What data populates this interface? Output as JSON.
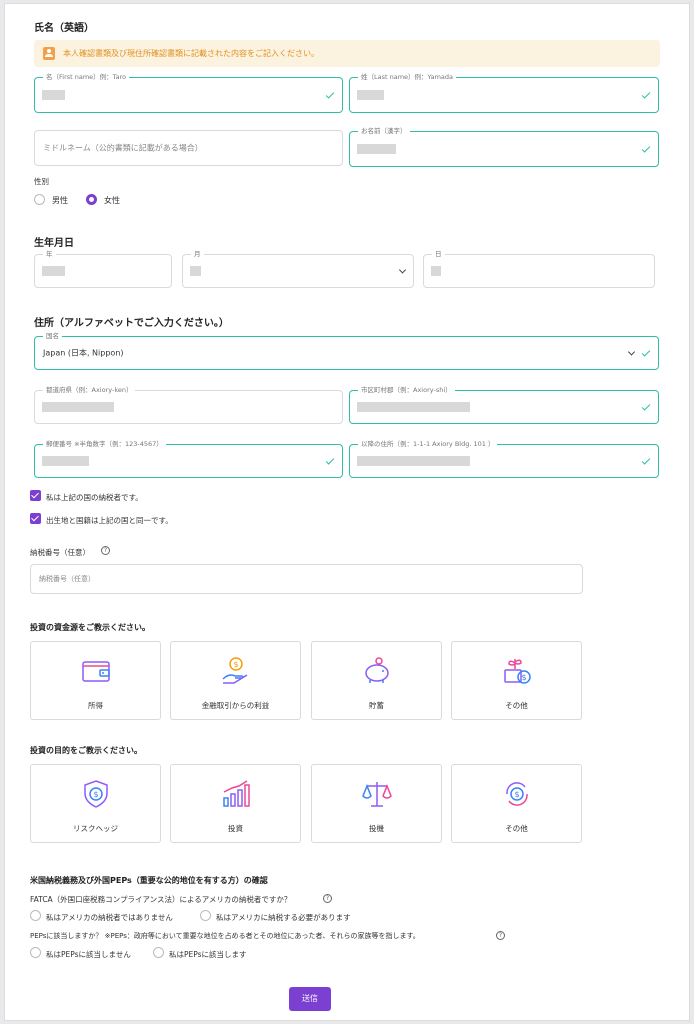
{
  "name_section": {
    "title": "氏名（英語）",
    "notice": "本人確認書類及び現住所確認書類に記載された内容をご記入ください。",
    "first_name_label": "名（First name）例：Taro",
    "last_name_label": "姓（Last name）例：Yamada",
    "middle_name_placeholder": "ミドルネーム（公的書類に記載がある場合）",
    "kanji_name_label": "お名前（漢字）"
  },
  "gender": {
    "label": "性別",
    "options": [
      "男性",
      "女性"
    ],
    "selected": "女性"
  },
  "birth": {
    "title": "生年月日",
    "year_label": "年",
    "month_label": "月",
    "day_label": "日"
  },
  "address": {
    "title": "住所（アルファベットでご入力ください。）",
    "country_label": "国名",
    "country_value": "Japan (日本, Nippon)",
    "prefecture_label": "都道府県（例：Axiory-ken）",
    "city_label": "市区町村郡（例：Axiory-shi）",
    "postal_label": "郵便番号 ※半角数字（例：123-4567）",
    "street_label": "以降の住所（例：1-1-1 Axiory Bldg. 101 ）"
  },
  "checkboxes": {
    "taxpayer": "私は上記の国の納税者です。",
    "birthplace": "出生地と国籍は上記の国と同一です。"
  },
  "tax_number": {
    "label": "納税番号（任意）",
    "placeholder": "納税番号（任意）",
    "help": "?"
  },
  "funds": {
    "title": "投資の資金源をご教示ください。",
    "options": [
      {
        "label": "所得",
        "icon": "wallet-icon"
      },
      {
        "label": "金融取引からの利益",
        "icon": "coin-hand-icon"
      },
      {
        "label": "貯蓄",
        "icon": "piggy-bank-icon"
      },
      {
        "label": "その他",
        "icon": "plant-coins-icon"
      }
    ]
  },
  "purpose": {
    "title": "投資の目的をご教示ください。",
    "options": [
      {
        "label": "リスクヘッジ",
        "icon": "shield-dollar-icon"
      },
      {
        "label": "投資",
        "icon": "growth-chart-icon"
      },
      {
        "label": "投機",
        "icon": "scales-icon"
      },
      {
        "label": "その他",
        "icon": "cycle-dollar-icon"
      }
    ]
  },
  "us_peps": {
    "title": "米国納税義務及び外国PEPs（重要な公的地位を有する方）の確認",
    "fatca_question": "FATCA（外国口座税務コンプライアンス法）によるアメリカの納税者ですか？",
    "fatca_options": [
      "私はアメリカの納税者ではありません",
      "私はアメリカに納税する必要があります"
    ],
    "peps_question": "PEPsに該当しますか？ ※PEPs：政府等において重要な地位を占める者とその地位にあった者、それらの家族等を指します。",
    "peps_options": [
      "私はPEPsに該当しません",
      "私はPEPsに該当します"
    ]
  },
  "submit_label": "送信",
  "colors": {
    "accent": "#7b3fd1",
    "valid": "#2fbfa7",
    "notice_bg": "#fcf2e0",
    "notice_text": "#e0911f"
  }
}
